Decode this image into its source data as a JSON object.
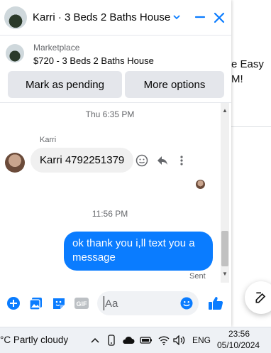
{
  "background": {
    "text_line_1": "e Easy",
    "text_line_2": "M!"
  },
  "chat": {
    "title": "Karri · 3 Beds 2 Baths House",
    "listing": {
      "source": "Marketplace",
      "title": "$720 - 3 Beds 2 Baths House"
    },
    "actions": {
      "pending_label": "Mark as pending",
      "more_label": "More options"
    },
    "messages": {
      "timestamp_1": "Thu 6:35 PM",
      "sender_name": "Karri",
      "received_text": "Karri 4792251379",
      "timestamp_2": "11:56 PM",
      "sent_text": "ok thank you i,ll text you a message",
      "sent_status": "Sent"
    },
    "composer": {
      "placeholder": "Aa",
      "gif_label": "GIF"
    },
    "colors": {
      "accent": "#0a7cff",
      "bubble_received": "#f0f0f0",
      "button_bg": "#e4e6eb"
    }
  },
  "taskbar": {
    "weather": "°C  Partly cloudy",
    "language": "ENG",
    "time": "23:56",
    "date": "05/10/2024"
  }
}
